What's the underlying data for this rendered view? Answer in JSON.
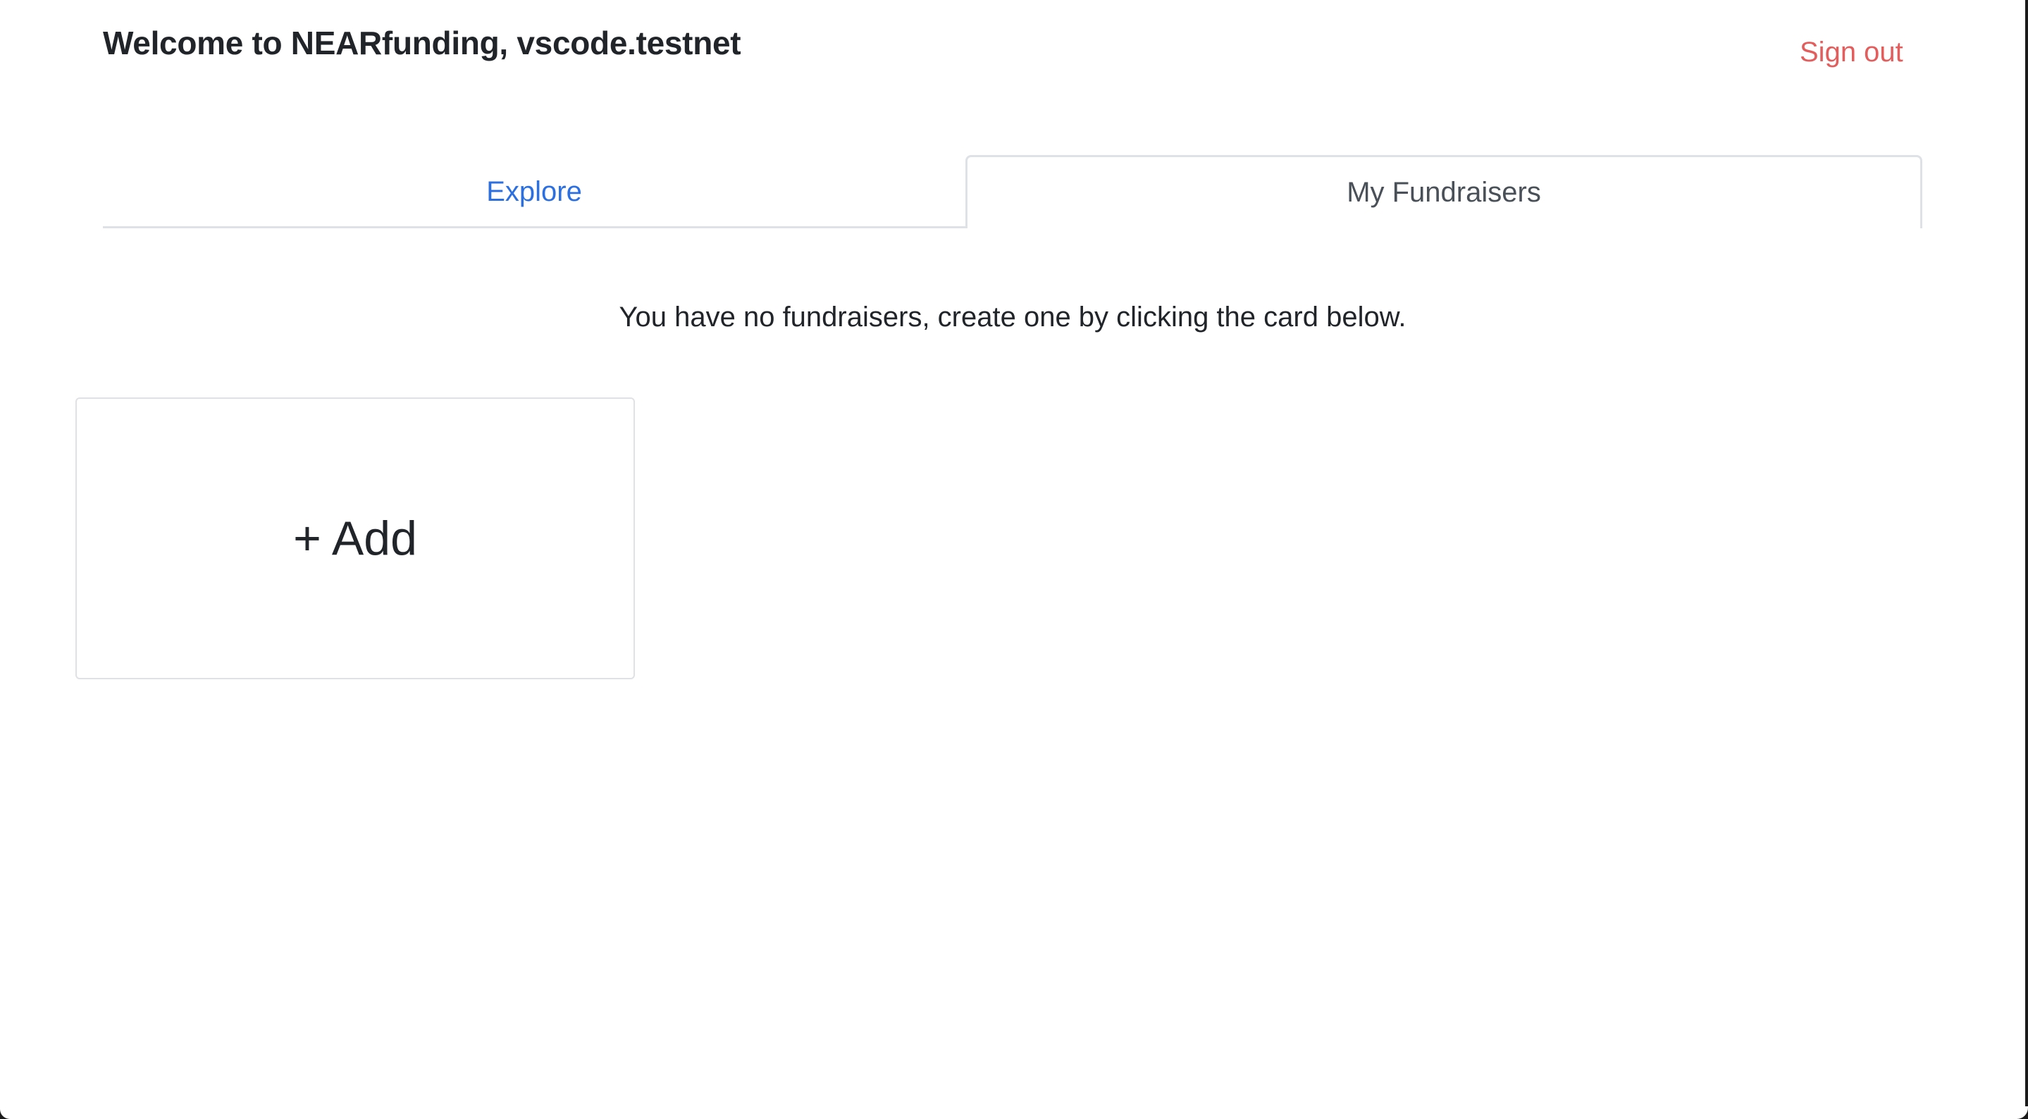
{
  "header": {
    "title": "Welcome to NEARfunding, vscode.testnet",
    "sign_out_label": "Sign out"
  },
  "tabs": [
    {
      "label": "Explore",
      "active": false
    },
    {
      "label": "My Fundraisers",
      "active": true
    }
  ],
  "main": {
    "empty_message": "You have no fundraisers, create one by clicking the card below.",
    "add_card_label": "+ Add"
  },
  "colors": {
    "link_blue": "#2b6fe0",
    "sign_out_red": "#e35d5d",
    "border_gray": "#dee2e6",
    "text_dark": "#212529"
  }
}
